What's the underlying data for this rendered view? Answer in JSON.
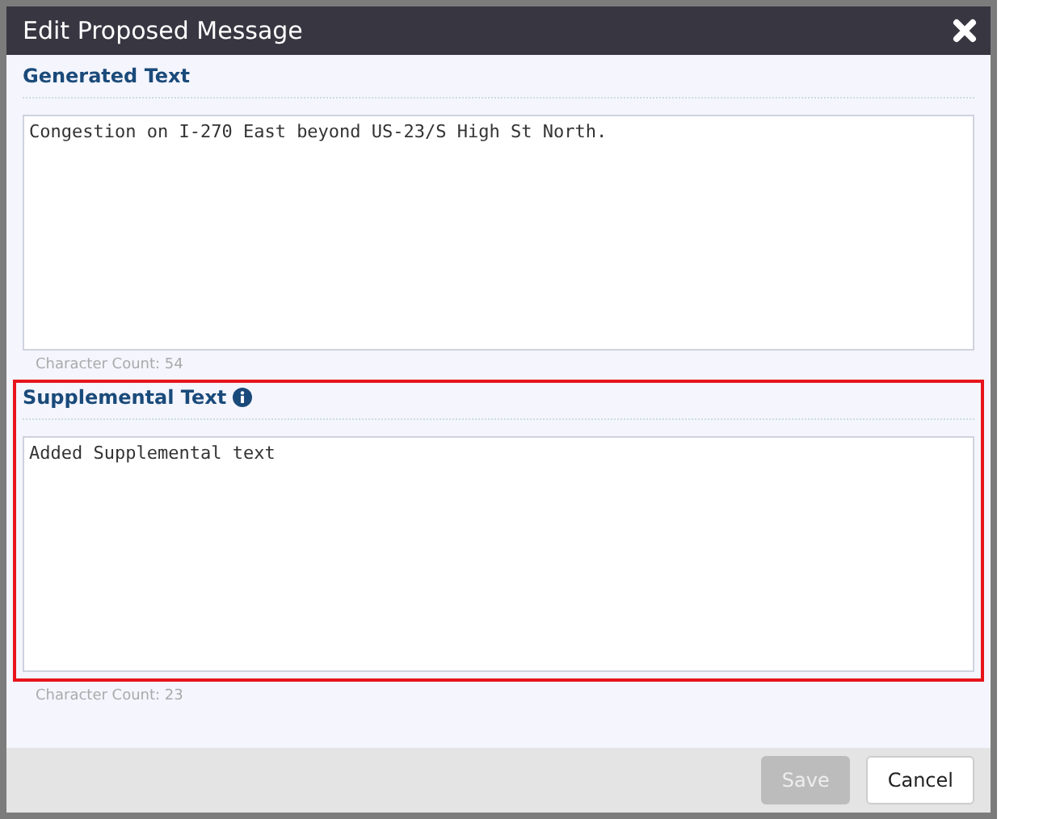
{
  "dialog": {
    "title": "Edit Proposed Message"
  },
  "sections": [
    {
      "label": "Generated Text",
      "info": false,
      "highlighted": false,
      "value": "Congestion on I-270 East beyond US-23/S High St North.",
      "count": "Character Count: 54"
    },
    {
      "label": "Supplemental Text",
      "info": true,
      "highlighted": true,
      "value": "Added Supplemental text",
      "count": "Character Count: 23"
    }
  ],
  "buttons": [
    {
      "label": "Save",
      "disabled": true
    },
    {
      "label": "Cancel",
      "disabled": false
    }
  ]
}
